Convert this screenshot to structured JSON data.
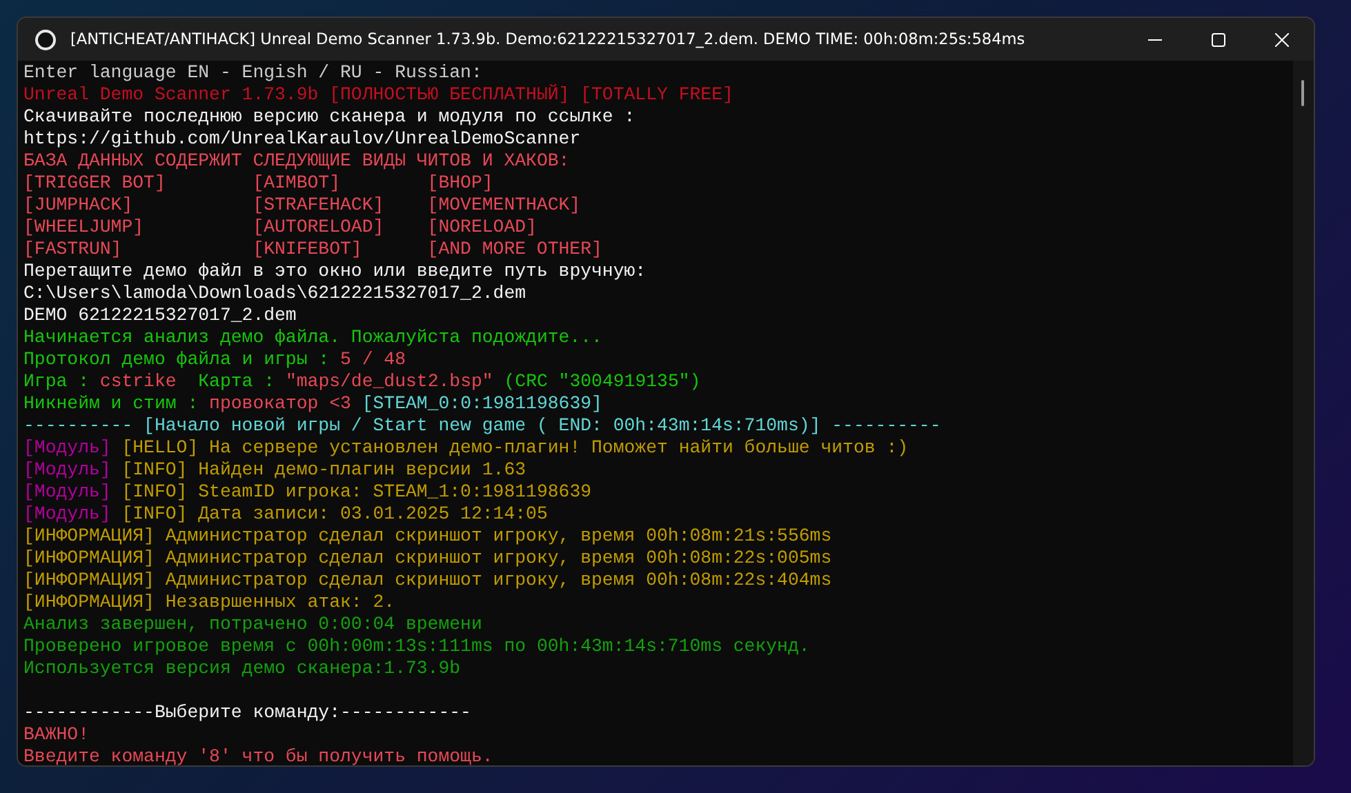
{
  "window": {
    "title": "[ANTICHEAT/ANTIHACK] Unreal Demo Scanner 1.73.9b. Demo:62122215327017_2.dem. DEMO TIME: 00h:08m:25s:584ms"
  },
  "console": {
    "lines": [
      {
        "kind": "text",
        "segments": [
          {
            "text": "Enter language EN - Engish / RU - Russian:",
            "color": "#cccccc"
          }
        ]
      },
      {
        "kind": "text",
        "segments": [
          {
            "text": "Unreal Demo Scanner 1.73.9b [ПОЛНОСТЬЮ БЕСПЛАТНЫЙ] [TOTALLY FREE]",
            "color": "#c50f1f"
          }
        ]
      },
      {
        "kind": "text",
        "segments": [
          {
            "text": "Скачивайте последнюю версию сканера и модуля по ссылке :",
            "color": "#f2f2f2"
          }
        ]
      },
      {
        "kind": "text",
        "segments": [
          {
            "text": "https://github.com/UnrealKaraulov/UnrealDemoScanner",
            "color": "#f2f2f2"
          }
        ]
      },
      {
        "kind": "text",
        "segments": [
          {
            "text": "БАЗА ДАННЫХ СОДЕРЖИТ СЛЕДУЮЩИЕ ВИДЫ ЧИТОВ И ХАКОВ:",
            "color": "#e74856"
          }
        ]
      },
      {
        "kind": "columns",
        "cells": [
          {
            "text": "[TRIGGER BOT]",
            "color": "#e74856"
          },
          {
            "text": "[AIMBOT]",
            "color": "#e74856"
          },
          {
            "text": "[BHOP]",
            "color": "#e74856"
          }
        ]
      },
      {
        "kind": "columns",
        "cells": [
          {
            "text": "[JUMPHACK]",
            "color": "#e74856"
          },
          {
            "text": "[STRAFEHACK]",
            "color": "#e74856"
          },
          {
            "text": "[MOVEMENTHACK]",
            "color": "#e74856"
          }
        ]
      },
      {
        "kind": "columns",
        "cells": [
          {
            "text": "[WHEELJUMP]",
            "color": "#e74856"
          },
          {
            "text": "[AUTORELOAD]",
            "color": "#e74856"
          },
          {
            "text": "[NORELOAD]",
            "color": "#e74856"
          }
        ]
      },
      {
        "kind": "columns",
        "cells": [
          {
            "text": "[FASTRUN]",
            "color": "#e74856"
          },
          {
            "text": "[KNIFEBOT]",
            "color": "#e74856"
          },
          {
            "text": "[AND MORE OTHER]",
            "color": "#e74856"
          }
        ]
      },
      {
        "kind": "text",
        "segments": [
          {
            "text": "Перетащите демо файл в это окно или введите путь вручную:",
            "color": "#f2f2f2"
          }
        ]
      },
      {
        "kind": "text",
        "segments": [
          {
            "text": "C:\\Users\\lamoda\\Downloads\\62122215327017_2.dem",
            "color": "#f2f2f2"
          }
        ]
      },
      {
        "kind": "text",
        "segments": [
          {
            "text": "DEMO 62122215327017_2.dem",
            "color": "#f2f2f2"
          }
        ]
      },
      {
        "kind": "text",
        "segments": [
          {
            "text": "Начинается анализ демо файла. Пожалуйста подождите...",
            "color": "#16c60c"
          }
        ]
      },
      {
        "kind": "text",
        "segments": [
          {
            "text": "Протокол демо файла и игры : ",
            "color": "#16c60c"
          },
          {
            "text": "5 / 48",
            "color": "#e74856"
          }
        ]
      },
      {
        "kind": "text",
        "segments": [
          {
            "text": "Игра : ",
            "color": "#16c60c"
          },
          {
            "text": "cstrike",
            "color": "#e74856"
          },
          {
            "text": "  Карта : ",
            "color": "#16c60c"
          },
          {
            "text": "\"maps/de_dust2.bsp\"",
            "color": "#e74856"
          },
          {
            "text": " (CRC \"3004919135\")",
            "color": "#16c60c"
          }
        ]
      },
      {
        "kind": "text",
        "segments": [
          {
            "text": "Никнейм и стим : ",
            "color": "#16c60c"
          },
          {
            "text": "провокатор <3",
            "color": "#e74856"
          },
          {
            "text": " [STEAM_0:0:1981198639]",
            "color": "#61d6d6"
          }
        ]
      },
      {
        "kind": "text",
        "segments": [
          {
            "text": "---------- [Начало новой игры / Start new game ( END: 00h:43m:14s:710ms)] ----------",
            "color": "#61d6d6"
          }
        ]
      },
      {
        "kind": "text",
        "segments": [
          {
            "text": "[Модуль]",
            "color": "#b4009e"
          },
          {
            "text": " [HELLO] На сервере установлен демо-плагин! Поможет найти больше читов :)",
            "color": "#c19c00"
          }
        ]
      },
      {
        "kind": "text",
        "segments": [
          {
            "text": "[Модуль]",
            "color": "#b4009e"
          },
          {
            "text": " [INFO] Найден демо-плагин версии 1.63",
            "color": "#c19c00"
          }
        ]
      },
      {
        "kind": "text",
        "segments": [
          {
            "text": "[Модуль]",
            "color": "#b4009e"
          },
          {
            "text": " [INFO] SteamID игрока: STEAM_1:0:1981198639",
            "color": "#c19c00"
          }
        ]
      },
      {
        "kind": "text",
        "segments": [
          {
            "text": "[Модуль]",
            "color": "#b4009e"
          },
          {
            "text": " [INFO] Дата записи: 03.01.2025 12:14:05",
            "color": "#c19c00"
          }
        ]
      },
      {
        "kind": "text",
        "segments": [
          {
            "text": "[ИНФОРМАЦИЯ] Администратор сделал скриншот игроку, время 00h:08m:21s:556ms",
            "color": "#c19c00"
          }
        ]
      },
      {
        "kind": "text",
        "segments": [
          {
            "text": "[ИНФОРМАЦИЯ] Администратор сделал скриншот игроку, время 00h:08m:22s:005ms",
            "color": "#c19c00"
          }
        ]
      },
      {
        "kind": "text",
        "segments": [
          {
            "text": "[ИНФОРМАЦИЯ] Администратор сделал скриншот игроку, время 00h:08m:22s:404ms",
            "color": "#c19c00"
          }
        ]
      },
      {
        "kind": "text",
        "segments": [
          {
            "text": "[ИНФОРМАЦИЯ] Незавршенных атак: 2.",
            "color": "#c19c00"
          }
        ]
      },
      {
        "kind": "text",
        "segments": [
          {
            "text": "Анализ завершен, потрачено 0:00:04 времени",
            "color": "#13a10e"
          }
        ]
      },
      {
        "kind": "text",
        "segments": [
          {
            "text": "Проверено игровое время с 00h:00m:13s:111ms по 00h:43m:14s:710ms секунд.",
            "color": "#13a10e"
          }
        ]
      },
      {
        "kind": "text",
        "segments": [
          {
            "text": "Используется версия демо сканера:1.73.9b",
            "color": "#13a10e"
          }
        ]
      },
      {
        "kind": "blank"
      },
      {
        "kind": "text",
        "segments": [
          {
            "text": "------------Выберите команду:------------",
            "color": "#f2f2f2"
          }
        ]
      },
      {
        "kind": "text",
        "segments": [
          {
            "text": "ВАЖНО!",
            "color": "#e74856"
          }
        ]
      },
      {
        "kind": "text",
        "segments": [
          {
            "text": "Введите команду '8' что бы получить помощь.",
            "color": "#e74856"
          }
        ]
      }
    ]
  }
}
